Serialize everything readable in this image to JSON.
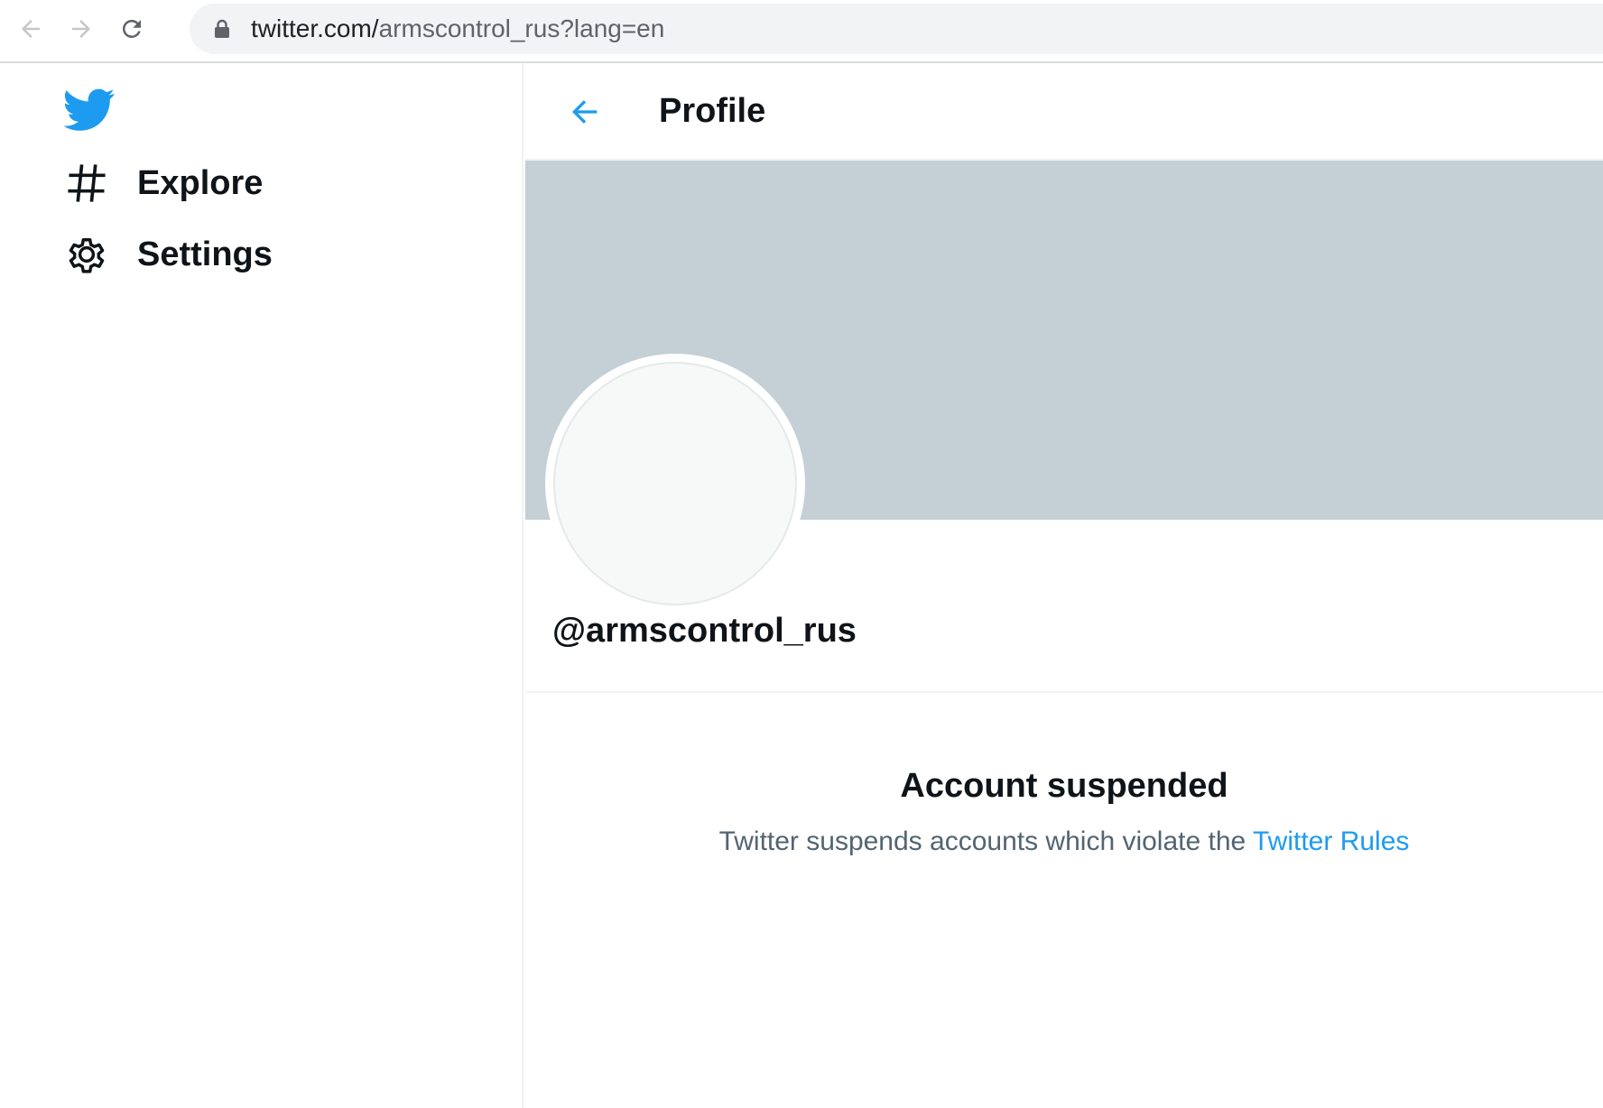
{
  "browser": {
    "url_host": "twitter.com/",
    "url_path": "armscontrol_rus?lang=en",
    "icons": [
      "back-arrow-icon",
      "forward-arrow-icon",
      "reload-icon",
      "lock-icon"
    ]
  },
  "sidebar": {
    "logo": "twitter-bird-icon",
    "items": [
      {
        "label": "Explore",
        "icon": "hashtag-icon"
      },
      {
        "label": "Settings",
        "icon": "gear-icon"
      }
    ]
  },
  "header": {
    "title": "Profile",
    "back_icon": "back-arrow-icon"
  },
  "profile": {
    "handle": "@armscontrol_rus"
  },
  "suspension": {
    "title": "Account suspended",
    "message": "Twitter suspends accounts which violate the ",
    "link_label": "Twitter Rules"
  },
  "colors": {
    "accent": "#1d9bf0",
    "banner": "#c4cfd6",
    "secondary_text": "#536471",
    "primary_text": "#0f1419"
  }
}
